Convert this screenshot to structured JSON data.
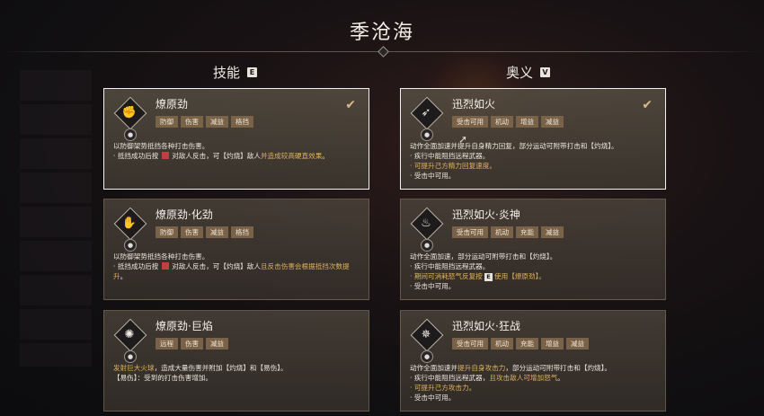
{
  "title": "季沧海",
  "columns": {
    "left": {
      "label": "技能",
      "key": "E"
    },
    "right": {
      "label": "奥义",
      "key": "V"
    }
  },
  "skills": [
    {
      "name": "燎原劲",
      "tags": [
        "防御",
        "伤害",
        "减益",
        "格挡"
      ],
      "selected": true,
      "icon": "fist-stance-icon",
      "lines": [
        [
          {
            "t": "以防御架势抵挡各种打击伤害。"
          }
        ],
        [
          {
            "t": "· 抵挡成功后按 "
          },
          {
            "icon": "mouse-right"
          },
          {
            "t": " 对敌人反击，可【灼烧】敌人"
          },
          {
            "t": "并造成较高硬直效果",
            "hl": true
          },
          {
            "t": "。"
          }
        ]
      ]
    },
    {
      "name": "燎原劲·化劲",
      "tags": [
        "防御",
        "伤害",
        "减益",
        "格挡"
      ],
      "selected": false,
      "icon": "palm-strike-icon",
      "lines": [
        [
          {
            "t": "以防御架势抵挡各种打击伤害。"
          }
        ],
        [
          {
            "t": "· 抵挡成功后按 "
          },
          {
            "icon": "mouse-right"
          },
          {
            "t": " 对敌人反击，可【灼烧】敌人"
          },
          {
            "t": "且反击伤害会根据抵挡次数提升",
            "hl": true
          },
          {
            "t": "。"
          }
        ]
      ]
    },
    {
      "name": "燎原劲·巨焰",
      "tags": [
        "远程",
        "伤害",
        "减益"
      ],
      "selected": false,
      "icon": "flame-blast-icon",
      "lines": [
        [
          {
            "t": "发射巨大火球",
            "hl": true
          },
          {
            "t": "，造成大量伤害并附加【灼烧】和【易伤】。"
          }
        ],
        [
          {
            "t": "【易伤】：受到的打击伤害增加。"
          }
        ]
      ]
    }
  ],
  "ultimates": [
    {
      "name": "迅烈如火",
      "tags": [
        "受击可用",
        "机动",
        "增益",
        "减益"
      ],
      "selected": true,
      "icon": "rushing-fire-icon",
      "lines": [
        [
          {
            "t": "动作全面加速并提升自身精力回复，部分运动可附带打击和【灼烧】。"
          }
        ],
        [
          {
            "t": "· 疾行中能阻挡远程武器。"
          }
        ],
        [
          {
            "t": "· 可提升己方精力回复速度。",
            "hl": true
          }
        ],
        [
          {
            "t": "· 受击中可用。"
          }
        ]
      ]
    },
    {
      "name": "迅烈如火·炎神",
      "tags": [
        "受击可用",
        "机动",
        "充能",
        "减益"
      ],
      "selected": false,
      "icon": "flame-god-icon",
      "lines": [
        [
          {
            "t": "动作全面加速，部分运动可附带打击和【灼烧】。"
          }
        ],
        [
          {
            "t": "· 疾行中能阻挡远程武器。"
          }
        ],
        [
          {
            "t": "· 期间可消耗怒气反复按 ",
            "hl": true
          },
          {
            "key": "E"
          },
          {
            "t": " 使用【燎原劲】。",
            "hl": true
          }
        ],
        [
          {
            "t": "· 受击中可用。"
          }
        ]
      ]
    },
    {
      "name": "迅烈如火·狂战",
      "tags": [
        "受击可用",
        "机动",
        "充能",
        "增益",
        "减益"
      ],
      "selected": false,
      "icon": "berserk-icon",
      "lines": [
        [
          {
            "t": "动作全面加速并"
          },
          {
            "t": "提升自身攻击力",
            "hl": true
          },
          {
            "t": "，部分运动可附带打击和【灼烧】。"
          }
        ],
        [
          {
            "t": "· 疾行中能阻挡远程武器，"
          },
          {
            "t": "且攻击敌人可增加怒气",
            "hl": true
          },
          {
            "t": "。"
          }
        ],
        [
          {
            "t": "· 可提升己方攻击力。",
            "hl": true
          }
        ],
        [
          {
            "t": "· 受击中可用。"
          }
        ]
      ]
    }
  ]
}
